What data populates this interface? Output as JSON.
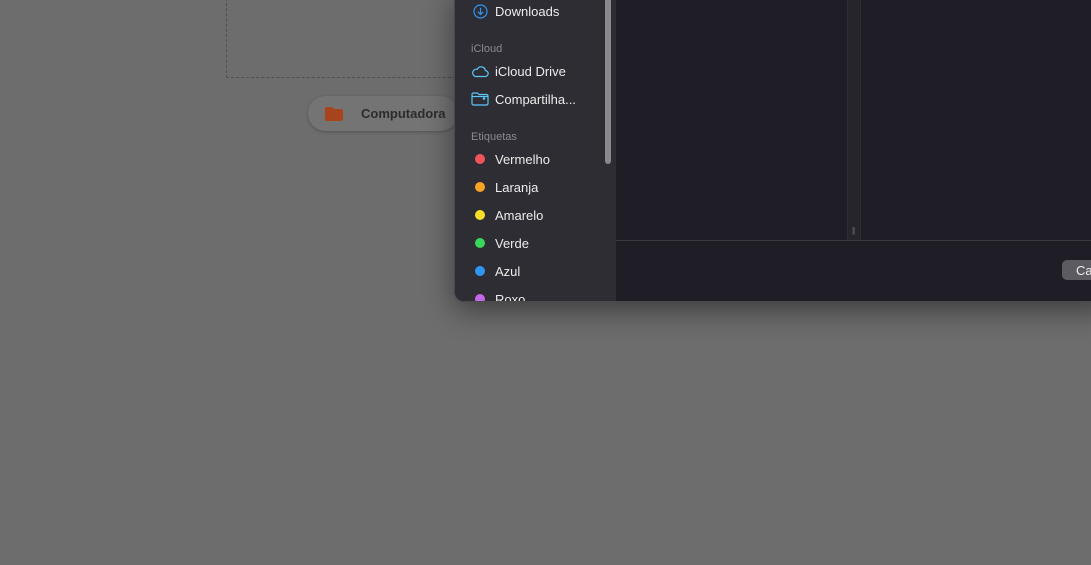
{
  "background": {
    "source_chip_label": "Computadora"
  },
  "sidebar": {
    "downloads_label": "Downloads",
    "icloud_section": "iCloud",
    "icloud_drive_label": "iCloud Drive",
    "shared_label": "Compartilha...",
    "tags_section": "Etiquetas",
    "tags": [
      {
        "label": "Vermelho",
        "color": "#f2545b"
      },
      {
        "label": "Laranja",
        "color": "#f7a325"
      },
      {
        "label": "Amarelo",
        "color": "#f7e025"
      },
      {
        "label": "Verde",
        "color": "#38d65a"
      },
      {
        "label": "Azul",
        "color": "#2f95f5"
      },
      {
        "label": "Roxo",
        "color": "#c466e8"
      }
    ]
  },
  "footer": {
    "cancel_label": "Ca"
  },
  "colors": {
    "accent": "#2f95f5",
    "icloud_icon": "#5ac8fa",
    "folder_icon": "#b0461f"
  }
}
